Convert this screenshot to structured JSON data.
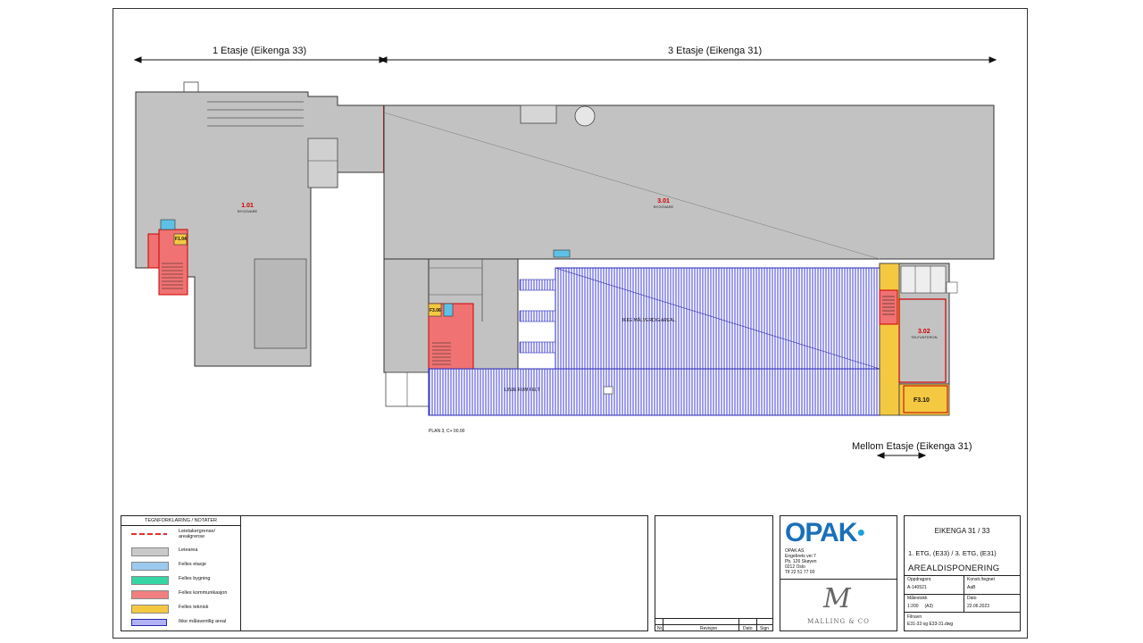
{
  "dimensions": {
    "left_label": "1 Etasje (Eikenga 33)",
    "right_label": "3 Etasje (Eikenga 31)",
    "mezz_label": "Mellom Etasje (Eikenga 31)"
  },
  "rooms": {
    "r101": {
      "number": "1.01",
      "name": "BYGGVARE"
    },
    "r301": {
      "number": "3.01",
      "name": "BYGGVARE"
    },
    "r302": {
      "number": "3.02",
      "name": "TELFUNTERON"
    },
    "f310": "F3.10",
    "hatch1_label": "IKKE MÅLVERDIG AREAL",
    "hatch2_label": "LINJE RUM FELT",
    "plan_note": "PLAN 3, C+ 00.00",
    "f1_label": "F1.04",
    "f3_label": "F3.06"
  },
  "legend": {
    "title": "TEGNFORKLARING / NOTATER",
    "items": [
      {
        "label": "Leietakergrense/ arealgrense",
        "color": "#e03030"
      },
      {
        "label": "Leiearea",
        "color": "#c9c9c9"
      },
      {
        "label": "Felles etasje",
        "color": "#9ccaef"
      },
      {
        "label": "Felles bygning",
        "color": "#35d6a4"
      },
      {
        "label": "Felles kommunikasjon",
        "color": "#f08080"
      },
      {
        "label": "Felles teknisk",
        "color": "#f5c842"
      },
      {
        "label": "Ikke målaventlig areal",
        "color": "#4a4ae0"
      }
    ]
  },
  "revision": {
    "cols": [
      "Nr.",
      "Revisjon",
      "Dato",
      "Sign"
    ]
  },
  "company": {
    "logo": "OPAK",
    "name": "OPAK AS",
    "street": "Engebrets vei 7",
    "pb": "Pb. 126 Skøyen",
    "city": "0212 Oslo",
    "tel": "Tlf 22 51 77 00",
    "client": "MALLING & CO"
  },
  "project": {
    "title": "EIKENGA 31 / 33",
    "floors": "1. ETG, (E33) / 3. ETG, (E31)",
    "subject": "AREALDISPONERING"
  },
  "meta": {
    "order_label": "Oppdragsnr.",
    "order": "A-140521",
    "drawn_label": "Konstr./tegnet",
    "drawn": "AaB",
    "scale_label": "Målestokk",
    "scale": "1:200     (A3)",
    "date_label": "Dato",
    "date": "22.06.2023",
    "file_label": "Filnavn",
    "file": "E31-33 og E33-31.dwg"
  },
  "colors": {
    "grey": "#bdbdbd",
    "red": "#f07272",
    "yellow": "#f5c842",
    "blue": "#3d3de0",
    "cyan": "#5fc0e6",
    "accent": "#1aa3d8"
  }
}
